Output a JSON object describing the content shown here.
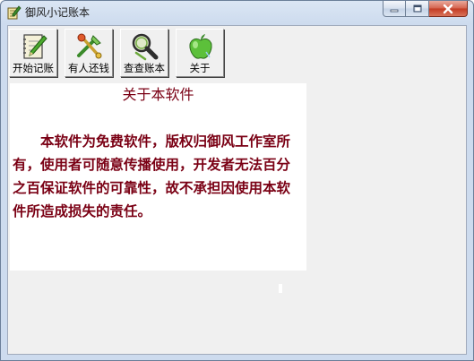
{
  "window": {
    "title": "御风小记账本",
    "app_icon": "ledger-pen-icon"
  },
  "caption_buttons": {
    "minimize_icon": "minimize-icon",
    "maximize_icon": "maximize-icon",
    "close_icon": "close-icon"
  },
  "toolbar": {
    "buttons": [
      {
        "label": "开始记账",
        "icon": "notebook-pencil-icon"
      },
      {
        "label": "有人还钱",
        "icon": "crossed-tools-icon"
      },
      {
        "label": "查查账本",
        "icon": "magnifier-icon"
      },
      {
        "label": "关于",
        "icon": "apple-icon"
      }
    ]
  },
  "about": {
    "heading": "关于本软件",
    "body": "本软件为免费软件，版权归御风工作室所有，使用者可随意传播使用，开发者无法百分之百保证软件的可靠性，故不承担因使用本软件所造成损失的责任。"
  },
  "colors": {
    "text_accent": "#7a0014",
    "client_bg": "#f0f0f0",
    "panel_bg": "#ffffff"
  }
}
